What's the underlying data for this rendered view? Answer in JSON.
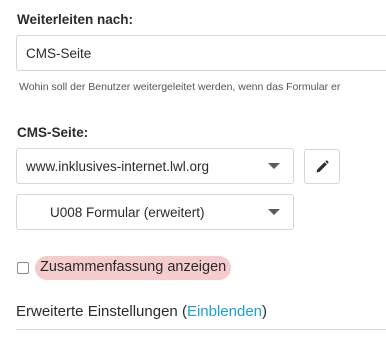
{
  "redirect": {
    "label": "Weiterleiten nach:",
    "selected": "CMS-Seite",
    "help": "Wohin soll der Benutzer weitergeleitet werden, wenn das Formular er"
  },
  "cms_page": {
    "label": "CMS-Seite:",
    "site_selected": "www.inklusives-internet.lwl.org",
    "page_selected": "U008 Formular (erweitert)"
  },
  "icons": {
    "edit": "pencil-icon",
    "dropdown": "chevron-down-icon"
  },
  "summary": {
    "label": "Zusammenfassung anzeigen",
    "checked": false
  },
  "advanced": {
    "text": "Erweiterte Einstellungen",
    "open_paren": "(",
    "link": "Einblenden",
    "close_paren": ")"
  },
  "colors": {
    "highlight": "#f3cccb",
    "link": "#1aa1d9"
  }
}
